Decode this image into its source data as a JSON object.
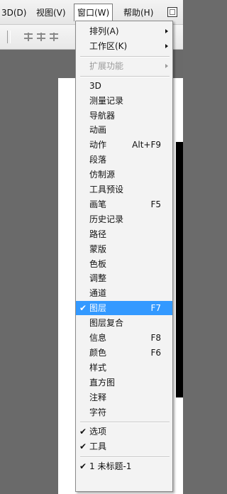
{
  "menubar": {
    "items": [
      "3D(D)",
      "视图(V)",
      "窗口(W)",
      "帮助(H)"
    ],
    "active_index": 2
  },
  "menu": {
    "groups": [
      [
        {
          "label": "排列(A)",
          "submenu": true
        },
        {
          "label": "工作区(K)",
          "submenu": true
        }
      ],
      [
        {
          "label": "扩展功能",
          "submenu": true,
          "disabled": true
        }
      ],
      [
        {
          "label": "3D"
        },
        {
          "label": "测量记录"
        },
        {
          "label": "导航器"
        },
        {
          "label": "动画"
        },
        {
          "label": "动作",
          "shortcut": "Alt+F9"
        },
        {
          "label": "段落"
        },
        {
          "label": "仿制源"
        },
        {
          "label": "工具预设"
        },
        {
          "label": "画笔",
          "shortcut": "F5"
        },
        {
          "label": "历史记录"
        },
        {
          "label": "路径"
        },
        {
          "label": "蒙版"
        },
        {
          "label": "色板"
        },
        {
          "label": "调整"
        },
        {
          "label": "通道"
        },
        {
          "label": "图层",
          "shortcut": "F7",
          "checked": true,
          "selected": true
        },
        {
          "label": "图层复合"
        },
        {
          "label": "信息",
          "shortcut": "F8"
        },
        {
          "label": "颜色",
          "shortcut": "F6"
        },
        {
          "label": "样式"
        },
        {
          "label": "直方图"
        },
        {
          "label": "注释"
        },
        {
          "label": "字符"
        }
      ],
      [
        {
          "label": "选项",
          "checked": true
        },
        {
          "label": "工具",
          "checked": true
        }
      ],
      [
        {
          "label": "1 未标题-1",
          "checked": true
        }
      ]
    ]
  },
  "colors": {
    "selection": "#3399ff",
    "menu_bg": "#f3f3f3",
    "canvas_bg": "#6a6a6a"
  }
}
